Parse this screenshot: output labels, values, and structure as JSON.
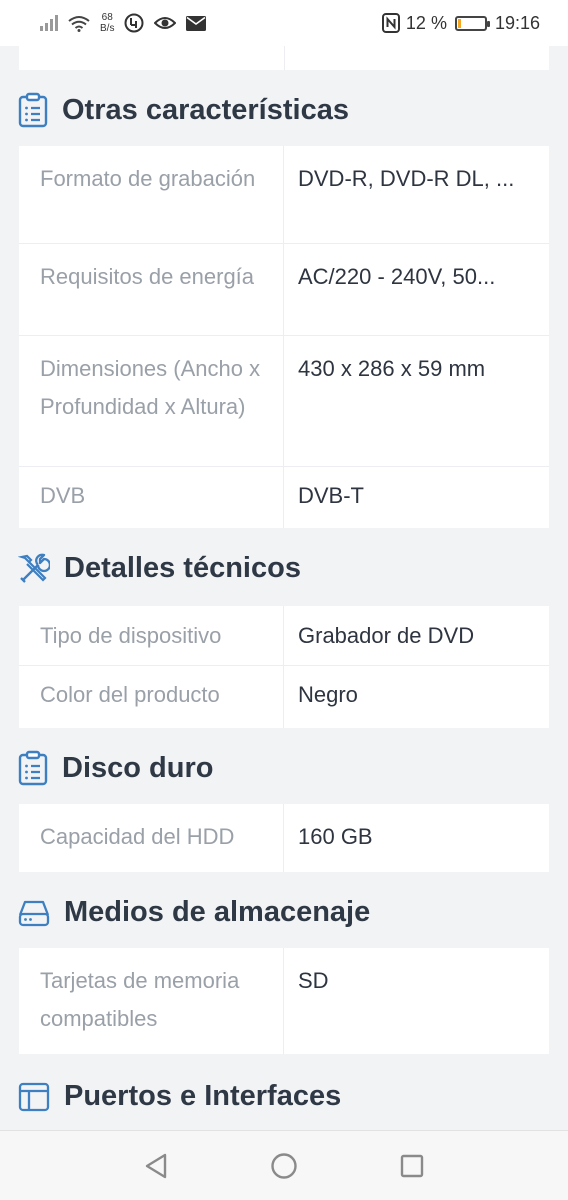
{
  "status_bar": {
    "net_speed_value": "68",
    "net_speed_unit": "B/s",
    "battery_text": "12 %",
    "time": "19:16",
    "battery_level": 0.12,
    "battery_color": "#f5a623"
  },
  "sections": [
    {
      "title": "Otras características",
      "icon": "clipboard-list-icon",
      "rows": [
        {
          "label": "Formato de grabación",
          "value": "DVD-R, DVD-R DL, ..."
        },
        {
          "label": "Requisitos de energía",
          "value": "AC/220 - 240V, 50..."
        },
        {
          "label": "Dimensiones (Ancho x Profundidad x Altura)",
          "value": "430 x 286 x 59 mm"
        },
        {
          "label": "DVB",
          "value": "DVB-T"
        }
      ]
    },
    {
      "title": "Detalles técnicos",
      "icon": "tools-icon",
      "rows": [
        {
          "label": "Tipo de dispositivo",
          "value": "Grabador de DVD"
        },
        {
          "label": "Color del producto",
          "value": "Negro"
        }
      ]
    },
    {
      "title": "Disco duro",
      "icon": "clipboard-list-icon",
      "rows": [
        {
          "label": "Capacidad del HDD",
          "value": "160 GB"
        }
      ]
    },
    {
      "title": "Medios de almacenaje",
      "icon": "hard-drive-icon",
      "rows": [
        {
          "label": "Tarjetas de memoria compatibles",
          "value": "SD"
        }
      ]
    },
    {
      "title": "Puertos e Interfaces",
      "icon": "layout-icon",
      "rows": []
    }
  ],
  "colors": {
    "accent_icon": "#3d7fc1",
    "title_text": "#2f3845",
    "label_text": "#9aa0a8",
    "value_text": "#2e3540"
  }
}
